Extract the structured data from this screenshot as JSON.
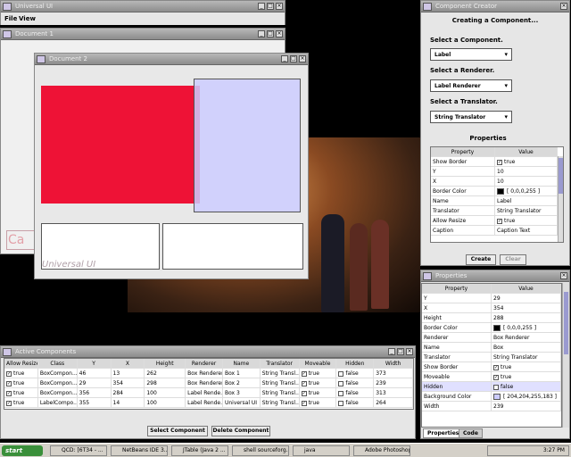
{
  "main_window": {
    "title": "Universal UI",
    "menu": [
      "File",
      "View"
    ]
  },
  "document1": {
    "title": "Document 1",
    "faded_text": "Ca"
  },
  "document2": {
    "title": "Document 2",
    "caption": "Universal UI",
    "colors": {
      "red_box": "#ee1236",
      "blue_box": "#cfcdf1"
    }
  },
  "component_creator": {
    "title": "Component Creator",
    "heading": "Creating a Component...",
    "select_component_label": "Select a Component.",
    "component_value": "Label",
    "select_renderer_label": "Select a Renderer.",
    "renderer_value": "Label Renderer",
    "select_translator_label": "Select a Translator.",
    "translator_value": "String Translator",
    "properties_heading": "Properties",
    "columns": [
      "Property",
      "Value"
    ],
    "rows": [
      {
        "property": "Show Border",
        "value": "true",
        "kind": "check"
      },
      {
        "property": "Y",
        "value": "10",
        "kind": "text"
      },
      {
        "property": "X",
        "value": "10",
        "kind": "text"
      },
      {
        "property": "Border Color",
        "value": "[ 0,0,0,255 ]",
        "kind": "color",
        "color": "#000000"
      },
      {
        "property": "Name",
        "value": "Label",
        "kind": "text"
      },
      {
        "property": "Translator",
        "value": "String Translator",
        "kind": "text"
      },
      {
        "property": "Allow Resize",
        "value": "true",
        "kind": "check"
      },
      {
        "property": "Caption",
        "value": "Caption Text",
        "kind": "text"
      }
    ],
    "create_label": "Create",
    "clear_label": "Clear"
  },
  "properties_panel": {
    "title": "Properties",
    "columns": [
      "Property",
      "Value"
    ],
    "rows": [
      {
        "property": "Y",
        "value": "29",
        "kind": "text"
      },
      {
        "property": "X",
        "value": "354",
        "kind": "text"
      },
      {
        "property": "Height",
        "value": "288",
        "kind": "text"
      },
      {
        "property": "Border Color",
        "value": "[ 0,0,0,255 ]",
        "kind": "color",
        "color": "#000000"
      },
      {
        "property": "Renderer",
        "value": "Box Renderer",
        "kind": "text"
      },
      {
        "property": "Name",
        "value": "Box",
        "kind": "text"
      },
      {
        "property": "Translator",
        "value": "String Translator",
        "kind": "text"
      },
      {
        "property": "Show Border",
        "value": "true",
        "kind": "check"
      },
      {
        "property": "Moveable",
        "value": "true",
        "kind": "check"
      },
      {
        "property": "Hidden",
        "value": "false",
        "kind": "uncheck"
      },
      {
        "property": "Background Color",
        "value": "[ 204,204,255,183 ]",
        "kind": "color",
        "color": "#ccccff"
      },
      {
        "property": "Width",
        "value": "239",
        "kind": "text"
      }
    ],
    "tabs": [
      "Properties",
      "Code"
    ]
  },
  "active_components": {
    "title": "Active Components",
    "columns": [
      "Allow Resize",
      "Class",
      "Y",
      "X",
      "Height",
      "Renderer",
      "Name",
      "Translator",
      "Moveable",
      "Hidden",
      "Width"
    ],
    "rows": [
      [
        "true",
        "BoxCompon...",
        "46",
        "13",
        "262",
        "Box Renderer",
        "Box 1",
        "String Transl...",
        "true",
        "false",
        "373"
      ],
      [
        "true",
        "BoxCompon...",
        "29",
        "354",
        "298",
        "Box Renderer",
        "Box 2",
        "String Transl...",
        "true",
        "false",
        "239"
      ],
      [
        "true",
        "BoxCompon...",
        "356",
        "284",
        "100",
        "Label Rende...",
        "Box 3",
        "String Transl...",
        "true",
        "false",
        "313"
      ],
      [
        "true",
        "LabelCompo...",
        "355",
        "14",
        "100",
        "Label Rende...",
        "Universal UI",
        "String Transl...",
        "true",
        "false",
        "264"
      ]
    ],
    "select_label": "Select Component",
    "delete_label": "Delete Component"
  },
  "taskbar": {
    "start": "start",
    "items": [
      "QCD: [6T34 - ...",
      "NetBeans IDE 3...",
      "JTable (Java 2 ...",
      "shell sourceforg...",
      "java",
      "Adobe Photoshop"
    ],
    "clock": "3:27 PM"
  }
}
